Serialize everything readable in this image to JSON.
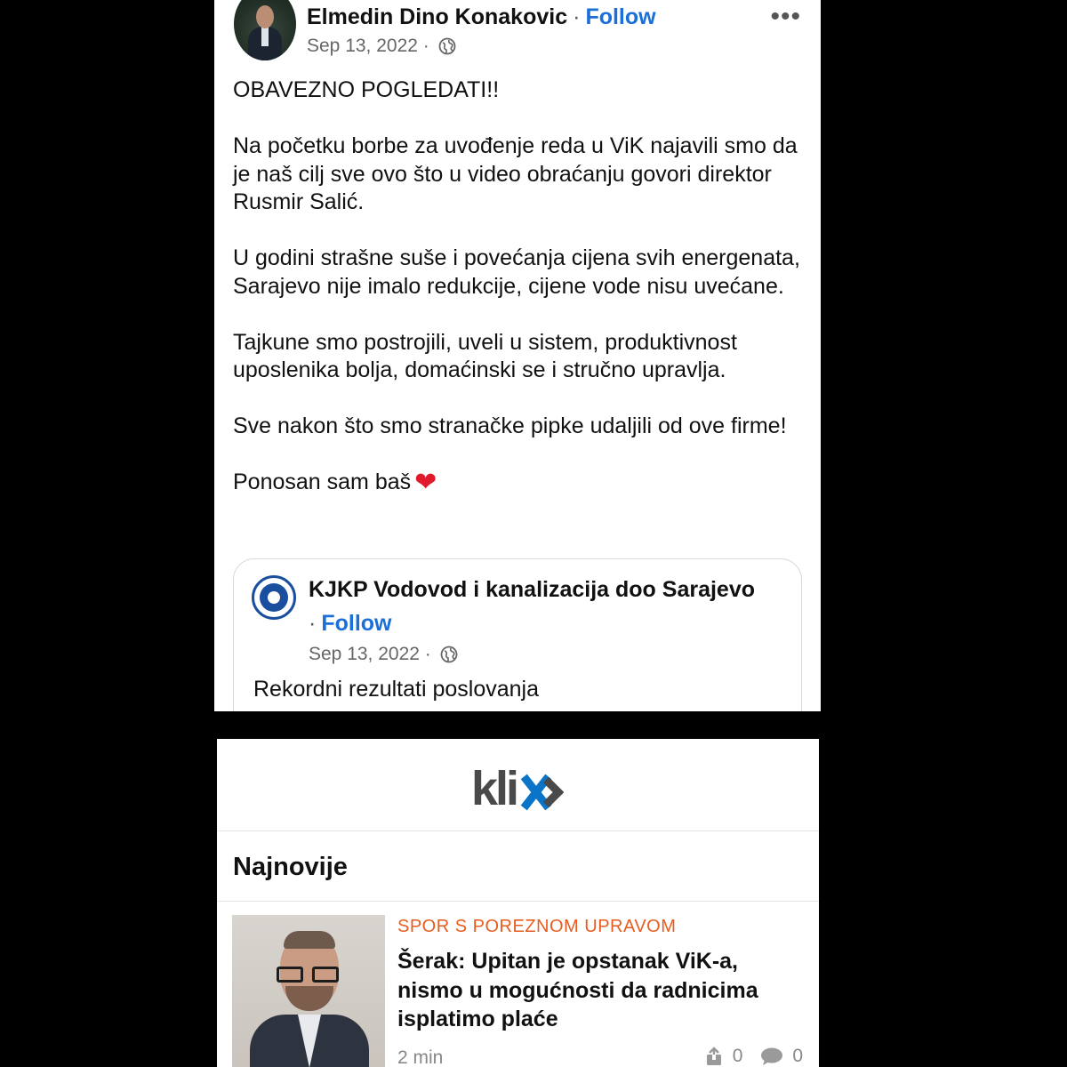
{
  "fb_post": {
    "author": "Elmedin Dino Konakovic",
    "separator": "·",
    "follow_label": "Follow",
    "more_label": "•••",
    "date": "Sep 13, 2022 ·",
    "privacy_icon": "globe-icon",
    "paragraphs": [
      "OBAVEZNO POGLEDATI!!",
      "Na početku borbe za uvođenje reda u ViK najavili smo da je naš cilj sve ovo što u video obraćanju govori direktor Rusmir Salić.",
      "U godini strašne suše i povećanja cijena svih energenata, Sarajevo nije imalo redukcije, cijene vode nisu uvećane.",
      "Tajkune smo postrojili, uveli u sistem, produktivnost uposlenika bolja, domaćinski se i stručno upravlja.",
      "Sve nakon što smo stranačke pipke udaljili od ove firme!"
    ],
    "closing_text": "Ponosan sam baš",
    "closing_emoji": "❤",
    "shared": {
      "page_name": "KJKP Vodovod i kanalizacija doo Sarajevo",
      "separator": "·",
      "follow_label": "Follow",
      "date": "Sep 13, 2022 ·",
      "text": "Rekordni rezultati poslovanja"
    },
    "colors": {
      "follow": "#1b6fd8",
      "heart": "#e0192b"
    }
  },
  "klix": {
    "logo_text": "klix",
    "section_title": "Najnovije",
    "article": {
      "kicker": "SPOR S POREZNOM UPRAVOM",
      "title": "Šerak: Upitan je opstanak ViK-a, nismo u mogućnosti da radnicima isplatimo plaće",
      "time": "2 min",
      "shares": "0",
      "comments": "0"
    },
    "colors": {
      "kicker": "#e85d1f",
      "logo_grey": "#4a4a4a",
      "logo_blue": "#0a74c9"
    }
  }
}
